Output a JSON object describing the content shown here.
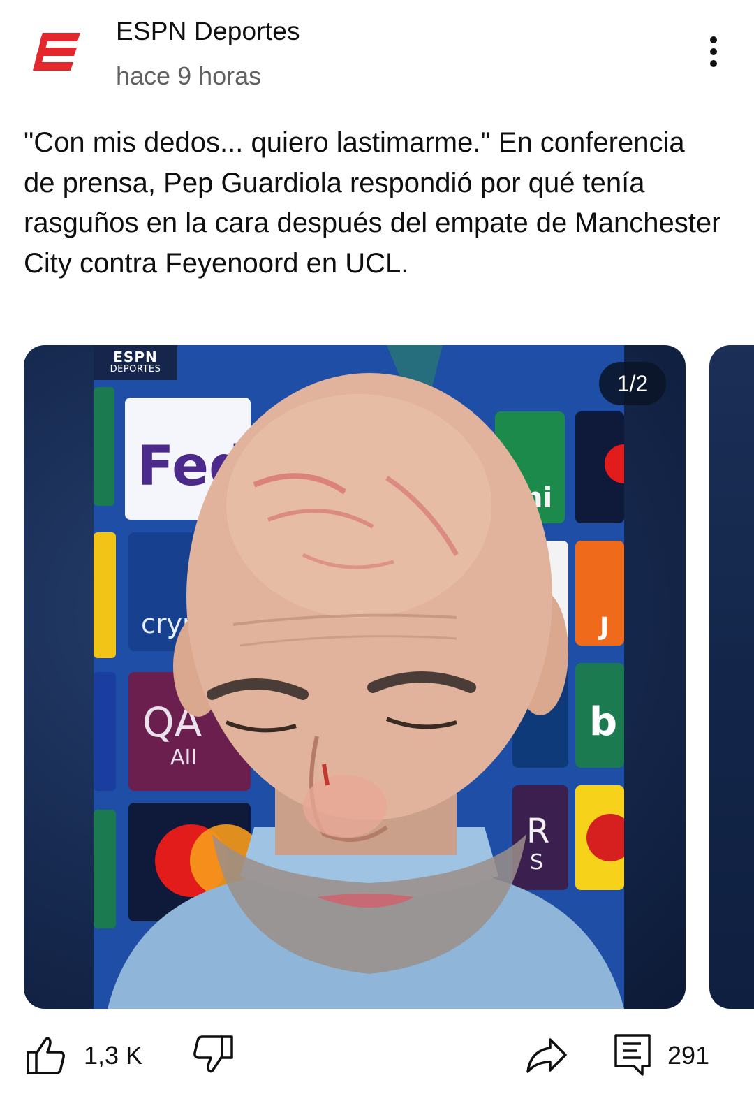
{
  "header": {
    "channel_name": "ESPN Deportes",
    "post_time": "hace 9 horas",
    "avatar_icon": "espn-e-logo-icon",
    "more_icon": "more-vertical-icon",
    "brand_color": "#e3272c"
  },
  "post": {
    "text": "\"Con mis dedos... quiero lastimarme.\" En conferencia de prensa, Pep Guardiola respondió por qué tenía rasguños en la cara después del empate de Manchester City contra Feyenoord en UCL."
  },
  "carousel": {
    "counter": "1/2",
    "current_index": 1,
    "total": 2,
    "broadcaster_logo_top": "ESPN",
    "broadcaster_logo_bottom": "DEPORTES",
    "backdrop_sponsor_texts": [
      "Fed",
      "cryp",
      "QA",
      "AII",
      "ni",
      "J",
      "b",
      "R",
      "S"
    ]
  },
  "actions": {
    "like_icon": "thumbs-up-icon",
    "like_count": "1,3 K",
    "dislike_icon": "thumbs-down-icon",
    "share_icon": "share-arrow-icon",
    "comments_icon": "comment-icon",
    "comment_count": "291"
  }
}
